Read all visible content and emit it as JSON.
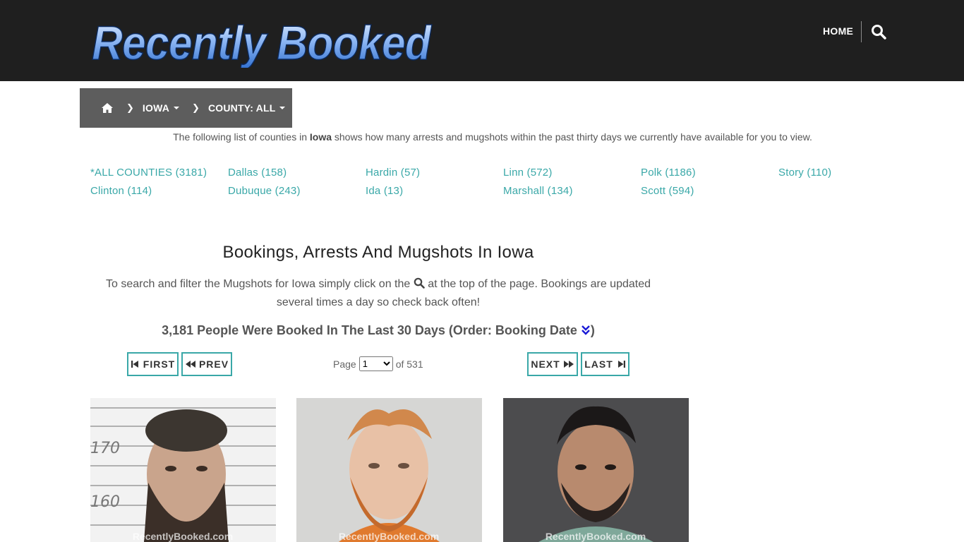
{
  "header": {
    "logo_text": "Recently Booked",
    "nav_home": "HOME",
    "search_icon": "search-icon"
  },
  "breadcrumb": {
    "home_icon": "home-icon",
    "state": "IOWA",
    "county": "COUNTY: ALL"
  },
  "intro": {
    "before": "The following list of counties in ",
    "state": "Iowa",
    "after": " shows how many arrests and mugshots within the past thirty days we currently have available for you to view."
  },
  "counties": [
    {
      "label": "*ALL COUNTIES (3181)"
    },
    {
      "label": "Dallas (158)"
    },
    {
      "label": "Hardin (57)"
    },
    {
      "label": "Linn (572)"
    },
    {
      "label": "Polk (1186)"
    },
    {
      "label": "Story (110)"
    },
    {
      "label": "Clinton (114)"
    },
    {
      "label": "Dubuque (243)"
    },
    {
      "label": "Ida (13)"
    },
    {
      "label": "Marshall (134)"
    },
    {
      "label": "Scott (594)"
    }
  ],
  "main": {
    "title": "Bookings, Arrests And Mugshots In Iowa",
    "desc_before": "To search and filter the Mugshots for Iowa simply click on the",
    "desc_after": "at the top of the page. Bookings are updated several times a day so check back often!",
    "booked_count": "3,181 People Were Booked In The Last 30 Days (Order: Booking Date",
    "booked_close": ")"
  },
  "pagination": {
    "first": "FIRST",
    "prev": "PREV",
    "next": "NEXT",
    "last": "LAST",
    "page_label": "Page",
    "current_page": "1",
    "of_label": "of 531"
  },
  "mugshots": [
    {
      "watermark": "RecentlyBooked.com"
    },
    {
      "watermark": "RecentlyBooked.com"
    },
    {
      "watermark": "RecentlyBooked.com"
    }
  ],
  "colors": {
    "header_bg": "#1f1f1f",
    "breadcrumb_bg": "#5d5d5d",
    "accent_teal": "#3aa8a8",
    "order_icon": "#1a1ad6"
  }
}
